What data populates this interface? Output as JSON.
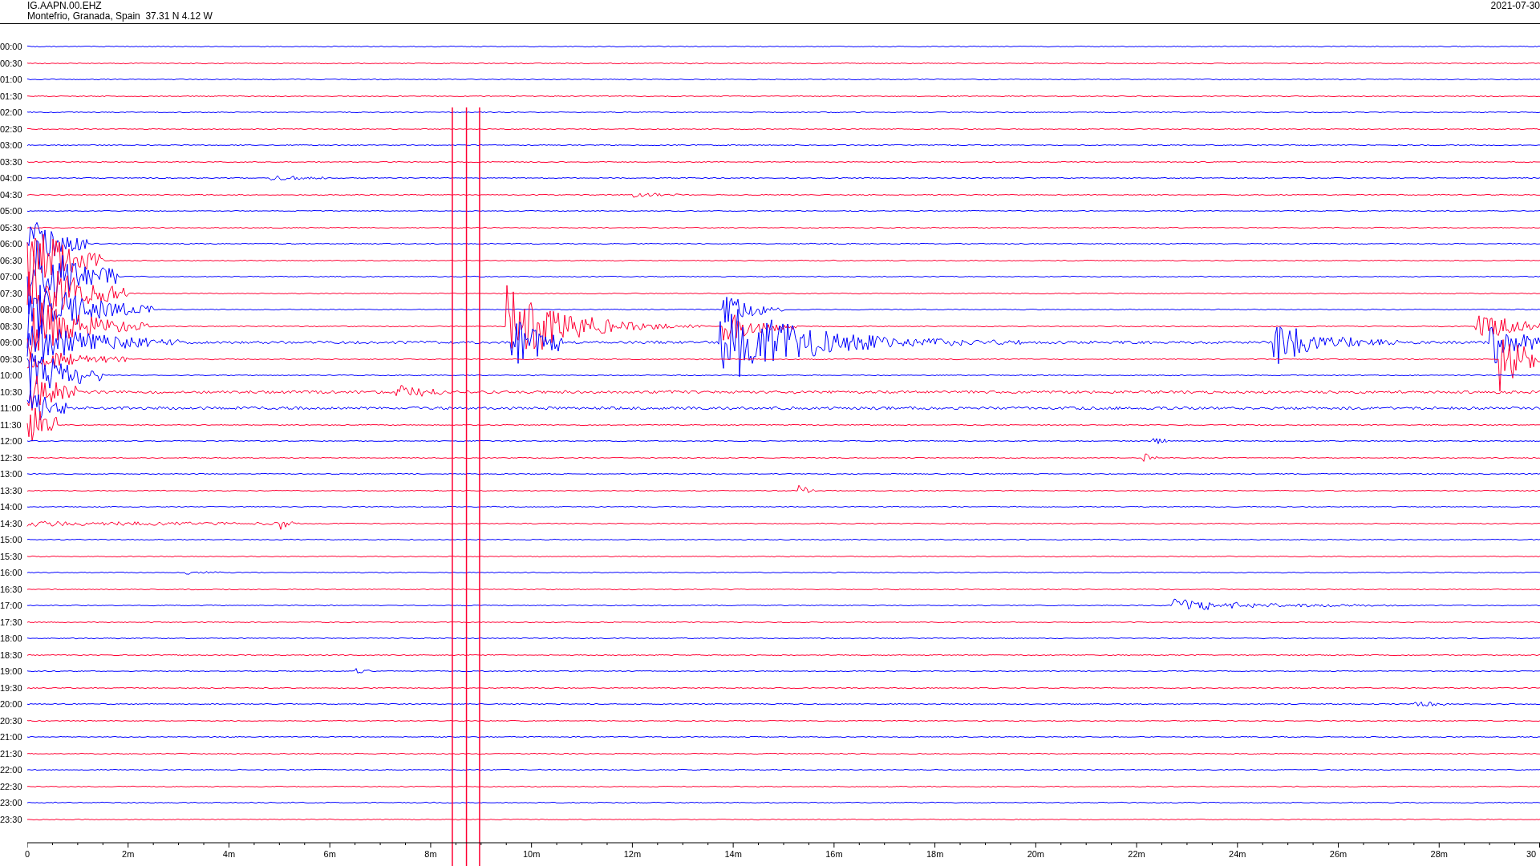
{
  "header": {
    "station": "IG.AAPN.00.EHZ",
    "location": "Montefrio, Granada, Spain  37.31 N 4.12 W",
    "date": "2021-07-30"
  },
  "rows": [
    {
      "time": "00:00",
      "color": "#0000ff"
    },
    {
      "time": "00:30",
      "color": "#ff0033"
    },
    {
      "time": "01:00",
      "color": "#0000ff"
    },
    {
      "time": "01:30",
      "color": "#ff0033"
    },
    {
      "time": "02:00",
      "color": "#0000ff"
    },
    {
      "time": "02:30",
      "color": "#ff0033"
    },
    {
      "time": "03:00",
      "color": "#0000ff"
    },
    {
      "time": "03:30",
      "color": "#ff0033"
    },
    {
      "time": "04:00",
      "color": "#0000ff"
    },
    {
      "time": "04:30",
      "color": "#ff0033"
    },
    {
      "time": "05:00",
      "color": "#0000ff"
    },
    {
      "time": "05:30",
      "color": "#ff0033"
    },
    {
      "time": "06:00",
      "color": "#0000ff"
    },
    {
      "time": "06:30",
      "color": "#ff0033"
    },
    {
      "time": "07:00",
      "color": "#0000ff"
    },
    {
      "time": "07:30",
      "color": "#ff0033"
    },
    {
      "time": "08:00",
      "color": "#0000ff"
    },
    {
      "time": "08:30",
      "color": "#ff0033"
    },
    {
      "time": "09:00",
      "color": "#0000ff"
    },
    {
      "time": "09:30",
      "color": "#ff0033"
    },
    {
      "time": "10:00",
      "color": "#0000ff"
    },
    {
      "time": "10:30",
      "color": "#ff0033"
    },
    {
      "time": "11:00",
      "color": "#0000ff"
    },
    {
      "time": "11:30",
      "color": "#ff0033"
    },
    {
      "time": "12:00",
      "color": "#0000ff"
    },
    {
      "time": "12:30",
      "color": "#ff0033"
    },
    {
      "time": "13:00",
      "color": "#0000ff"
    },
    {
      "time": "13:30",
      "color": "#ff0033"
    },
    {
      "time": "14:00",
      "color": "#0000ff"
    },
    {
      "time": "14:30",
      "color": "#ff0033"
    },
    {
      "time": "15:00",
      "color": "#0000ff"
    },
    {
      "time": "15:30",
      "color": "#ff0033"
    },
    {
      "time": "16:00",
      "color": "#0000ff"
    },
    {
      "time": "16:30",
      "color": "#ff0033"
    },
    {
      "time": "17:00",
      "color": "#0000ff"
    },
    {
      "time": "17:30",
      "color": "#ff0033"
    },
    {
      "time": "18:00",
      "color": "#0000ff"
    },
    {
      "time": "18:30",
      "color": "#ff0033"
    },
    {
      "time": "19:00",
      "color": "#0000ff"
    },
    {
      "time": "19:30",
      "color": "#ff0033"
    },
    {
      "time": "20:00",
      "color": "#0000ff"
    },
    {
      "time": "20:30",
      "color": "#ff0033"
    },
    {
      "time": "21:00",
      "color": "#0000ff"
    },
    {
      "time": "21:30",
      "color": "#ff0033"
    },
    {
      "time": "22:00",
      "color": "#0000ff"
    },
    {
      "time": "22:30",
      "color": "#ff0033"
    },
    {
      "time": "23:00",
      "color": "#0000ff"
    },
    {
      "time": "23:30",
      "color": "#ff0033"
    }
  ],
  "x_axis": {
    "labels": [
      "0",
      "2m",
      "4m",
      "6m",
      "8m",
      "10m",
      "12m",
      "14m",
      "16m",
      "18m",
      "20m",
      "22m",
      "24m",
      "26m",
      "28m",
      "30"
    ]
  }
}
